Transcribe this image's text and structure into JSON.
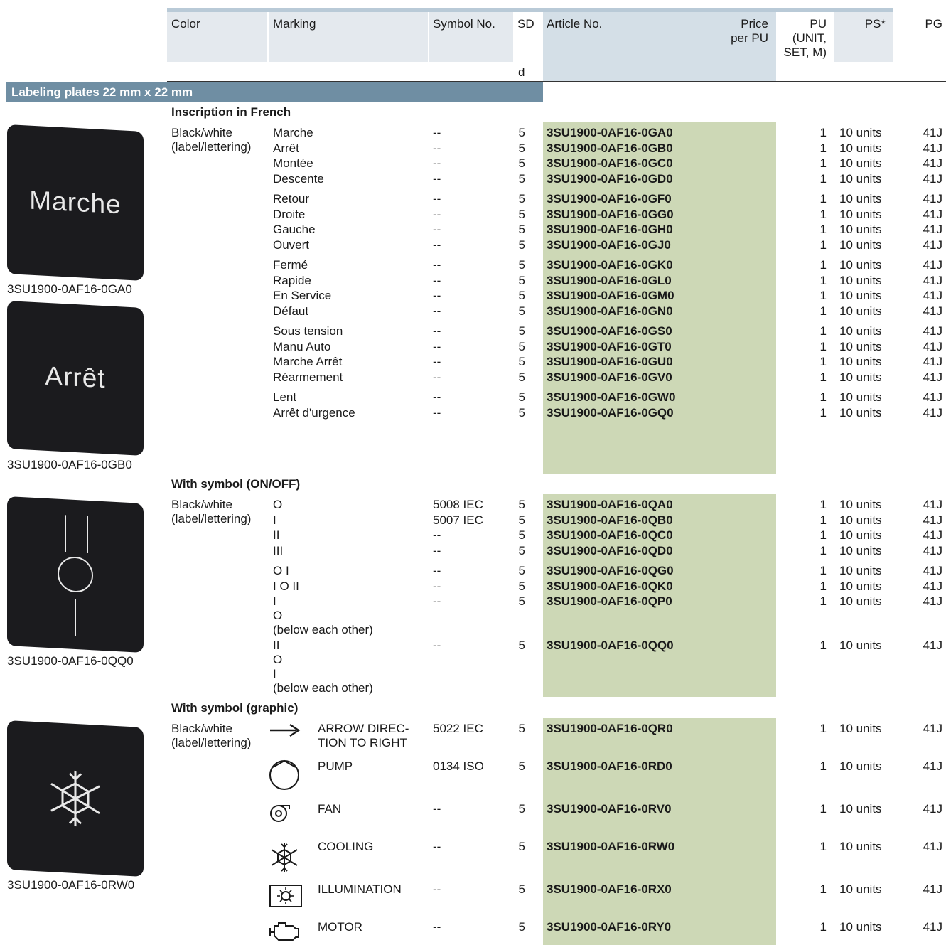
{
  "header": {
    "color": "Color",
    "marking": "Marking",
    "symbol_no": "Symbol No.",
    "sd": "SD",
    "sd_unit": "d",
    "article_no": "Article No.",
    "price_1": "Price",
    "price_2": "per PU",
    "pu_1": "PU",
    "pu_2": "(UNIT,",
    "pu_3": "SET, M)",
    "ps": "PS*",
    "pg": "PG"
  },
  "band_title": "Labeling plates 22 mm x 22 mm",
  "sections": {
    "french": "Inscription in French",
    "onoff": "With symbol (ON/OFF)",
    "graphic": "With symbol (graphic)"
  },
  "color_line1": "Black/white",
  "color_line2": "(label/lettering)",
  "pu_value": "1",
  "ps_value": "10 units",
  "pg_value": "41J",
  "sd_value": "5",
  "symbol_none": "--",
  "french_rows": [
    {
      "marking": "Marche",
      "article": "3SU1900-0AF16-0GA0"
    },
    {
      "marking": "Arrêt",
      "article": "3SU1900-0AF16-0GB0"
    },
    {
      "marking": "Montée",
      "article": "3SU1900-0AF16-0GC0"
    },
    {
      "marking": "Descente",
      "article": "3SU1900-0AF16-0GD0"
    },
    {
      "marking": "Retour",
      "article": "3SU1900-0AF16-0GF0"
    },
    {
      "marking": "Droite",
      "article": "3SU1900-0AF16-0GG0"
    },
    {
      "marking": "Gauche",
      "article": "3SU1900-0AF16-0GH0"
    },
    {
      "marking": "Ouvert",
      "article": "3SU1900-0AF16-0GJ0"
    },
    {
      "marking": "Fermé",
      "article": "3SU1900-0AF16-0GK0"
    },
    {
      "marking": "Rapide",
      "article": "3SU1900-0AF16-0GL0"
    },
    {
      "marking": "En Service",
      "article": "3SU1900-0AF16-0GM0"
    },
    {
      "marking": "Défaut",
      "article": "3SU1900-0AF16-0GN0"
    },
    {
      "marking": "Sous tension",
      "article": "3SU1900-0AF16-0GS0"
    },
    {
      "marking": "Manu Auto",
      "article": "3SU1900-0AF16-0GT0"
    },
    {
      "marking": "Marche Arrêt",
      "article": "3SU1900-0AF16-0GU0"
    },
    {
      "marking": "Réarmement",
      "article": "3SU1900-0AF16-0GV0"
    },
    {
      "marking": "Lent",
      "article": "3SU1900-0AF16-0GW0"
    },
    {
      "marking": "Arrêt d'urgence",
      "article": "3SU1900-0AF16-0GQ0"
    }
  ],
  "onoff_rows": [
    {
      "marking": "O",
      "symbol": "5008 IEC",
      "article": "3SU1900-0AF16-0QA0"
    },
    {
      "marking": "I",
      "symbol": "5007 IEC",
      "article": "3SU1900-0AF16-0QB0"
    },
    {
      "marking": "II",
      "symbol": "--",
      "article": "3SU1900-0AF16-0QC0"
    },
    {
      "marking": "III",
      "symbol": "--",
      "article": "3SU1900-0AF16-0QD0"
    },
    {
      "marking": "O I",
      "symbol": "--",
      "article": "3SU1900-0AF16-0QG0"
    },
    {
      "marking": "I O II",
      "symbol": "--",
      "article": "3SU1900-0AF16-0QK0"
    },
    {
      "marking": "I",
      "symbol": "--",
      "article": "3SU1900-0AF16-0QP0"
    },
    {
      "marking": "II",
      "symbol": "--",
      "article": "3SU1900-0AF16-0QQ0"
    }
  ],
  "onoff_extra": {
    "qp_line2": "O",
    "qp_line3": "(below each other)",
    "qq_line2": "O",
    "qq_line3": "I",
    "qq_line4": "(below each other)"
  },
  "graphic_rows": [
    {
      "icon": "arrow-right-icon",
      "marking_1": "ARROW DIREC-",
      "marking_2": "TION TO RIGHT",
      "symbol": "5022 IEC",
      "article": "3SU1900-0AF16-0QR0"
    },
    {
      "icon": "pump-icon",
      "marking_1": "PUMP",
      "marking_2": "",
      "symbol": "0134 ISO",
      "article": "3SU1900-0AF16-0RD0"
    },
    {
      "icon": "fan-icon",
      "marking_1": "FAN",
      "marking_2": "",
      "symbol": "--",
      "article": "3SU1900-0AF16-0RV0"
    },
    {
      "icon": "snowflake-icon",
      "marking_1": "COOLING",
      "marking_2": "",
      "symbol": "--",
      "article": "3SU1900-0AF16-0RW0"
    },
    {
      "icon": "illumination-icon",
      "marking_1": "ILLUMINATION",
      "marking_2": "",
      "symbol": "--",
      "article": "3SU1900-0AF16-0RX0"
    },
    {
      "icon": "motor-icon",
      "marking_1": "MOTOR",
      "marking_2": "",
      "symbol": "--",
      "article": "3SU1900-0AF16-0RY0"
    }
  ],
  "plates": [
    {
      "label": "Marche",
      "caption": "3SU1900-0AF16-0GA0"
    },
    {
      "label": "Arrêt",
      "caption": "3SU1900-0AF16-0GB0"
    },
    {
      "label": "",
      "caption": "3SU1900-0AF16-0QQ0"
    },
    {
      "label": "",
      "caption": "3SU1900-0AF16-0RW0"
    }
  ],
  "colors": {
    "header_bar": "#b9cad7",
    "band": "#6f8ea3",
    "article_column": "#cdd8b6",
    "plate": "#1b1b1e"
  }
}
